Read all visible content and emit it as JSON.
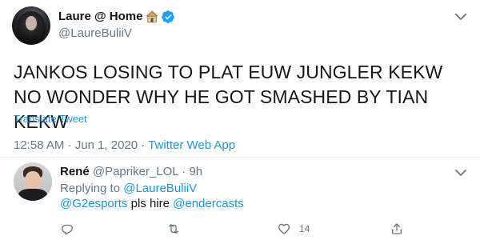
{
  "tweet": {
    "author": {
      "name": "Laure @ Home",
      "handle": "@LaureBuliiV",
      "avatar": "avatar"
    },
    "icons": {
      "house": "house-icon",
      "verified": "verified-icon",
      "more": "chevron-down-icon"
    },
    "text": "JANKOS LOSING TO PLAT EUW JUNGLER KEKW NO WONDER WHY HE GOT SMASHED BY TIAN KEKW",
    "translate_label": "Translate Tweet",
    "timestamp": "12:58 AM · Jun 1, 2020",
    "meta_separator": " · ",
    "source": "Twitter Web App"
  },
  "reply": {
    "name": "René",
    "handle": "@Papriker_LOL",
    "separator": " · ",
    "time": "9h",
    "replying_prefix": "Replying to ",
    "replying_to": "@LaureBuliiV",
    "mention": "@G2esports",
    "text_mid": " pls hire ",
    "mention2": "@endercasts",
    "actions": {
      "reply_count": "",
      "retweet_count": "",
      "like_count": "14",
      "share_label": ""
    }
  },
  "colors": {
    "link": "#1b95e0",
    "muted": "#657786",
    "text": "#14171a",
    "divider": "#e6ecf0",
    "verified": "#1da1f2"
  }
}
